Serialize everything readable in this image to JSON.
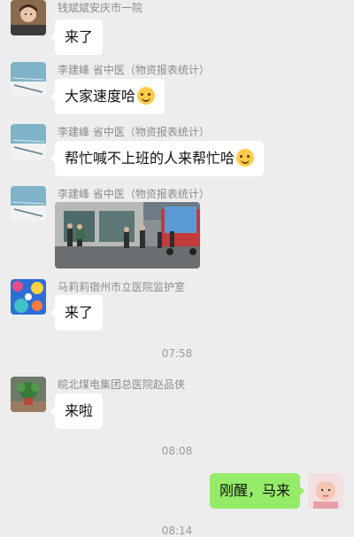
{
  "messages": [
    {
      "sender": "钱斌斌安庆市一院",
      "text": "来了",
      "avatar_icon": "child-portrait-avatar"
    },
    {
      "sender": "李建峰 省中医（物资报表统计）",
      "text": "大家速度哈",
      "emoji": "smiling-face",
      "avatar_icon": "sky-landscape-avatar"
    },
    {
      "sender": "李建峰 省中医（物资报表统计）",
      "text": "帮忙喊不上班的人来帮忙哈",
      "emoji": "smiling-face",
      "avatar_icon": "sky-landscape-avatar"
    },
    {
      "sender": "李建峰 省中医（物资报表统计）",
      "image_icon": "truck-unloading-photo",
      "avatar_icon": "sky-landscape-avatar"
    },
    {
      "sender": "马莉莉宿州市立医院监护室",
      "text": "来了",
      "avatar_icon": "colorful-artwork-avatar"
    },
    {
      "sender": "皖北煤电集团总医院赵品侠",
      "text": "来啦",
      "avatar_icon": "potted-plant-avatar"
    }
  ],
  "timestamps": [
    "07:58",
    "08:08",
    "08:14"
  ],
  "self_message": {
    "text": "刚醒，马来",
    "avatar_icon": "baby-avatar"
  },
  "colors": {
    "background": "#ededed",
    "bubble": "#ffffff",
    "self_bubble": "#95ec69",
    "sender_text": "#8c8c8c"
  }
}
